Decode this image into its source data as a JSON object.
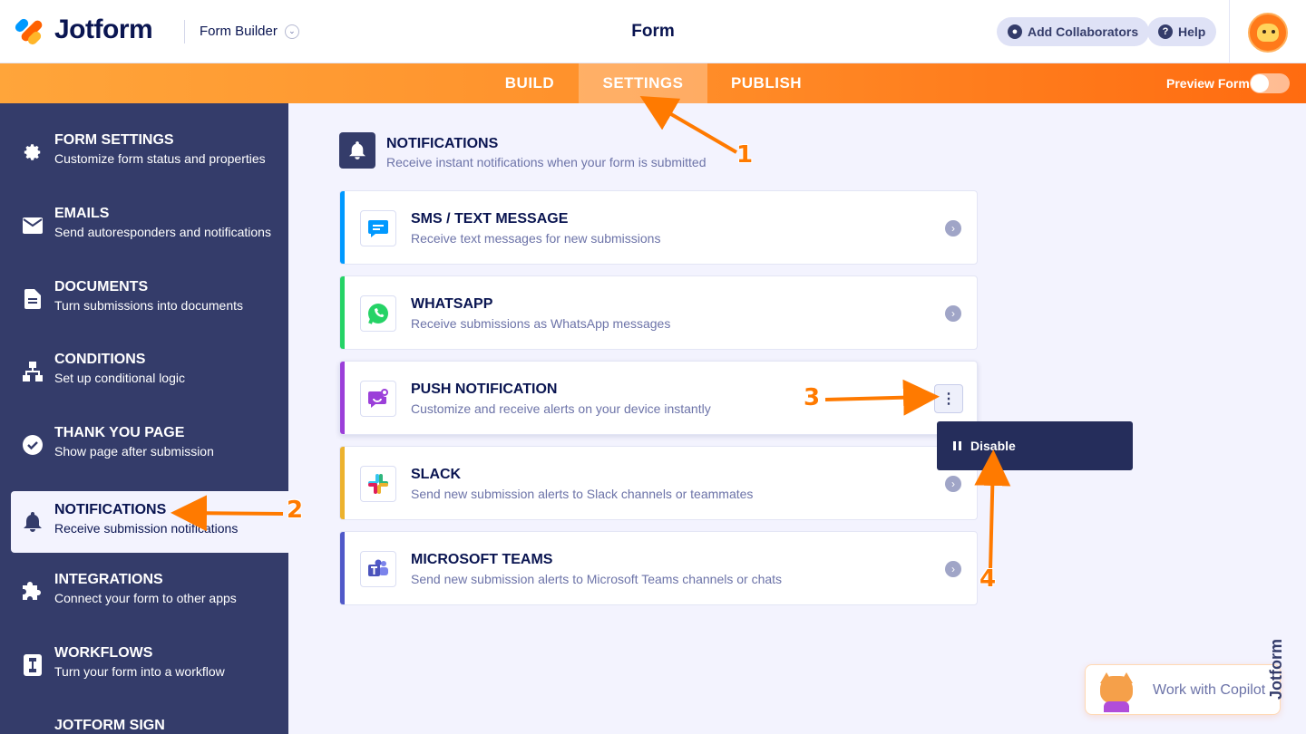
{
  "header": {
    "logo_text": "Jotform",
    "form_builder_label": "Form Builder",
    "page_title": "Form",
    "add_collaborators_label": "Add Collaborators",
    "help_label": "Help"
  },
  "nav": {
    "tabs": [
      {
        "label": "BUILD",
        "active": false
      },
      {
        "label": "SETTINGS",
        "active": true
      },
      {
        "label": "PUBLISH",
        "active": false
      }
    ],
    "preview_label": "Preview Form",
    "preview_enabled": false
  },
  "sidebar": {
    "items": [
      {
        "title": "FORM SETTINGS",
        "subtitle": "Customize form status and properties",
        "icon": "gear-icon"
      },
      {
        "title": "EMAILS",
        "subtitle": "Send autoresponders and notifications",
        "icon": "envelope-icon"
      },
      {
        "title": "DOCUMENTS",
        "subtitle": "Turn submissions into documents",
        "icon": "document-icon"
      },
      {
        "title": "CONDITIONS",
        "subtitle": "Set up conditional logic",
        "icon": "conditions-icon"
      },
      {
        "title": "THANK YOU PAGE",
        "subtitle": "Show page after submission",
        "icon": "check-circle-icon"
      },
      {
        "title": "NOTIFICATIONS",
        "subtitle": "Receive submission notifications",
        "icon": "bell-icon",
        "active": true
      },
      {
        "title": "INTEGRATIONS",
        "subtitle": "Connect your form to other apps",
        "icon": "puzzle-icon"
      },
      {
        "title": "WORKFLOWS",
        "subtitle": "Turn your form into a workflow",
        "icon": "workflow-icon"
      },
      {
        "title": "JOTFORM SIGN",
        "subtitle": "",
        "icon": "sign-icon"
      }
    ]
  },
  "section": {
    "title": "NOTIFICATIONS",
    "subtitle": "Receive instant notifications when your form is submitted",
    "icon": "bell-icon"
  },
  "cards": [
    {
      "title": "SMS / TEXT MESSAGE",
      "subtitle": "Receive text messages for new submissions",
      "icon": "sms-icon",
      "color": "#0099ff"
    },
    {
      "title": "WHATSAPP",
      "subtitle": "Receive submissions as WhatsApp messages",
      "icon": "whatsapp-icon",
      "color": "#25d366"
    },
    {
      "title": "PUSH NOTIFICATION",
      "subtitle": "Customize and receive alerts on your device instantly",
      "icon": "push-notification-icon",
      "color": "#9b3fd9"
    },
    {
      "title": "SLACK",
      "subtitle": "Send new submission alerts to Slack channels or teammates",
      "icon": "slack-icon",
      "color": "#ecb22e"
    },
    {
      "title": "MICROSOFT TEAMS",
      "subtitle": "Send new submission alerts to Microsoft Teams channels or chats",
      "icon": "teams-icon",
      "color": "#5059c9"
    }
  ],
  "dropdown": {
    "items": [
      {
        "label": "Disable",
        "icon": "pause-icon"
      }
    ]
  },
  "annotations": {
    "steps": [
      "1",
      "2",
      "3",
      "4"
    ],
    "color": "#ff7a00"
  },
  "copilot": {
    "label": "Work with Copilot"
  },
  "watermark": {
    "text": "Jotform"
  },
  "colors": {
    "brand_orange": "#ff6100",
    "navy": "#0a1551",
    "sidebar_bg": "#343c6a"
  }
}
